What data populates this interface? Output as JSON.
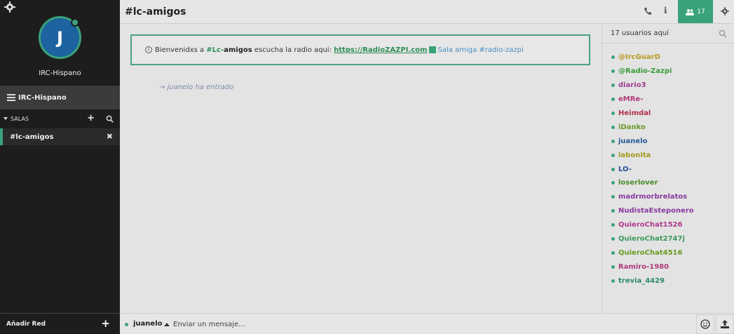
{
  "sidebar": {
    "avatar_letter": "J",
    "network_name": "IRC-Hispano",
    "network_row_label": "IRC-Hispano",
    "salas_label": "SALAS",
    "channel": "#lc-amigos",
    "add_network_label": "Añadir Red"
  },
  "header": {
    "title": "#lc-amigos",
    "user_count": "17"
  },
  "topic": {
    "prefix": "Bienvenidxs a",
    "channel_prefix": "#Lc-",
    "channel_suffix": "amigos",
    "middle": "escucha la radio aqui:",
    "link": "https://RadioZAZPI.com",
    "sala_amiga": "Sala amiga",
    "sala_channel": "#radio-zazpi"
  },
  "messages": [
    {
      "arrow": "→",
      "nick": "juanelo",
      "text": "ha entrado"
    }
  ],
  "users_panel": {
    "header": "17 usuarios aquí",
    "users": [
      {
        "name": "@IrcGuarD",
        "color": "#b99a1e"
      },
      {
        "name": "@Radio-Zazpi",
        "color": "#3a9a3a"
      },
      {
        "name": "diario3",
        "color": "#a03a8e"
      },
      {
        "name": "eMRe-",
        "color": "#b03a7a"
      },
      {
        "name": "Heimdal",
        "color": "#b0304a"
      },
      {
        "name": "iDanko",
        "color": "#6a9a2a"
      },
      {
        "name": "juanelo",
        "color": "#2a5a9a"
      },
      {
        "name": "labonita",
        "color": "#a09a20"
      },
      {
        "name": "LO-",
        "color": "#2a4aa0"
      },
      {
        "name": "loserlover",
        "color": "#4a8a2a"
      },
      {
        "name": "madrmorbrelatos",
        "color": "#8a3aa0"
      },
      {
        "name": "NudistaEsteponero",
        "color": "#8a3aa0"
      },
      {
        "name": "QuieroChat1526",
        "color": "#b03a8a"
      },
      {
        "name": "QuieroChat2747j",
        "color": "#3a9a5a"
      },
      {
        "name": "QuieroChat4516",
        "color": "#6a9a20"
      },
      {
        "name": "Ramiro-1980",
        "color": "#b03a7a"
      },
      {
        "name": "trevia_4429",
        "color": "#2a8a6a"
      }
    ]
  },
  "input": {
    "nick": "juanelo",
    "placeholder": "Enviar un mensaje..."
  },
  "colors": {
    "accent": "#3aa27a",
    "sidebar_bg": "#1d1d1d"
  }
}
